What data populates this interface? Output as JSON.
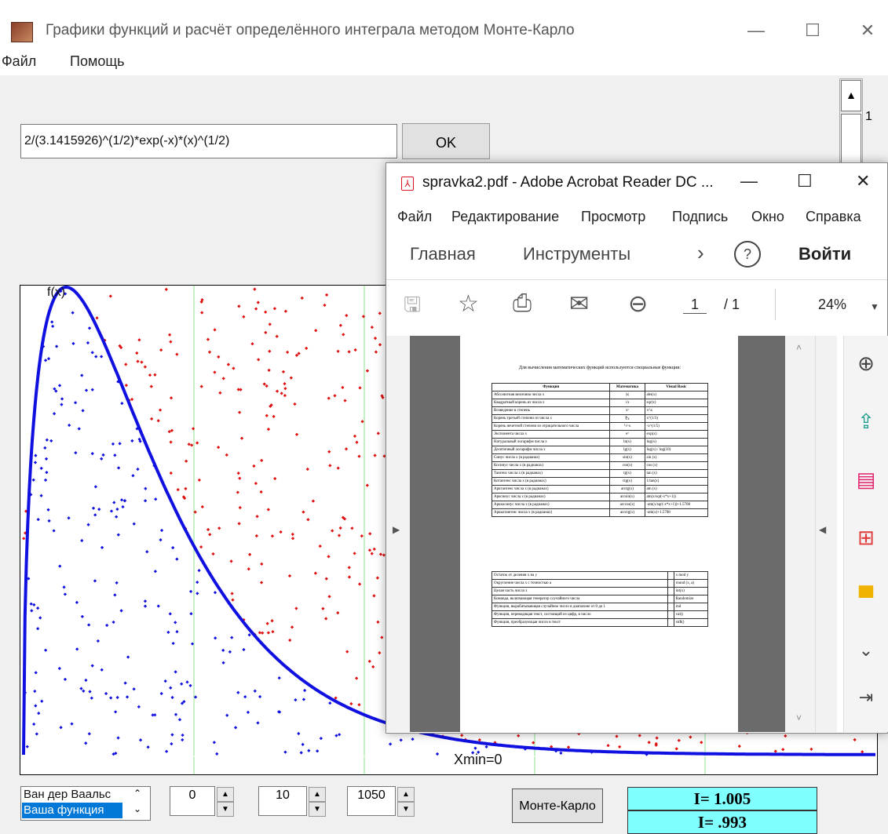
{
  "main_window": {
    "title": "Графики функций и расчёт определённого интеграла методом Монте-Карло",
    "controls": [
      "—",
      "☐",
      "✕"
    ],
    "menu": [
      "Файл",
      "Помощь"
    ],
    "formula": "2/(3.1415926)^(1/2)*exp(-x)*(x)^(1/2)",
    "ok_label": "OK",
    "scroll_value": "1"
  },
  "plot": {
    "fx_label": "f(x)",
    "xmin_label": "Xmin=0",
    "colors": {
      "curve": "#1010e0",
      "below": "#1010e0",
      "above": "#e01010",
      "grid": "#8ee08e"
    }
  },
  "bottom": {
    "listbox": [
      "Ван дер Ваальс",
      "Ваша функция"
    ],
    "spin_values": [
      "0",
      "10",
      "1050"
    ],
    "mc_label": "Монте-Карло",
    "results": [
      "I= 1.005",
      "I= .993"
    ]
  },
  "acrobat": {
    "title": "spravka2.pdf - Adobe Acrobat Reader DC ...",
    "controls": [
      "—",
      "☐",
      "✕"
    ],
    "menu": [
      "Файл",
      "Редактирование",
      "Просмотр",
      "Подпись",
      "Окно",
      "Справка"
    ],
    "nav": [
      "Главная",
      "Инструменты",
      "›",
      "?",
      "Войти"
    ],
    "toolbar_icons": [
      "save-icon",
      "star-icon",
      "print-icon",
      "mail-icon",
      "zoom-out-icon"
    ],
    "page_number": "1",
    "page_total": "/ 1",
    "zoom": "24%",
    "side_icons": [
      "zoom-in-icon",
      "export-pdf-icon",
      "organize-pages-icon",
      "create-pdf-icon",
      "comment-icon",
      "chevron-down-icon",
      "collapse-panel-icon"
    ],
    "pdf": {
      "heading": "Для вычисления математических функций используются специальные функции:",
      "table1_header": [
        "Функция",
        "Математика",
        "Visual Basic"
      ],
      "table1_rows": [
        [
          "Абсолютная величина числа x",
          "|x|",
          "abs(x)"
        ],
        [
          "Квадратный корень из числа x",
          "√x",
          "sqr(x)"
        ],
        [
          "Возведение в степень",
          "xᵃ",
          "x^a"
        ],
        [
          "Корень третьей степени из числа x",
          "∛x",
          "x^(1/3)"
        ],
        [
          "Корень нечетной степени из отрицательного числа",
          "⁵√-x",
          "-x^(1/5)"
        ],
        [
          "Экспонента числа x",
          "eˣ",
          "exp(x)"
        ],
        [
          "Натуральный логарифм числа x",
          "ln(x)",
          "log(x)"
        ],
        [
          "Десятичный логарифм числа x",
          "lg(x)",
          "log(x) / log(10)"
        ],
        [
          "Синус числа x (в радианах)",
          "sin(x)",
          "sin (x)"
        ],
        [
          "Косинус числа x (в радианах)",
          "cos(x)",
          "cos (x)"
        ],
        [
          "Тангенс числа x (в радианах)",
          "tg(x)",
          "tan (x)"
        ],
        [
          "Котангенс числа x (в радианах)",
          "ctg(x)",
          "1/tan(x)"
        ],
        [
          "Арктангенс числа x (в радианах)",
          "arctg(x)",
          "atn (x)"
        ],
        [
          "Арксинус числа x (в радианах)",
          "arcsin(x)",
          "atn(x/sqr(-x*x+1))"
        ],
        [
          "Арккосинус числа x (в радианах)",
          "arccos(x)",
          "-atn(x/sqr(-x*x+1))+1.5708"
        ],
        [
          "Арккотангенс числа x (в радианах)",
          "arcctg(x)",
          "-atn(x)+1.5708"
        ]
      ],
      "table2_rows": [
        [
          "Остаток от деления x на y",
          "",
          "x mod y"
        ],
        [
          "Округление числа x с точностью a",
          "",
          "round (x, a)"
        ],
        [
          "Целая часть числа x",
          "",
          "int(x)"
        ],
        [
          "Команда, включающая генератор случайного числа",
          "",
          "Randomize"
        ],
        [
          "Функция, вырабатывающая случайное число в диапазоне от 0 до 1",
          "",
          "rnd"
        ],
        [
          "Функция, переводящая текст, состоящий из цифр, в число",
          "",
          "val()"
        ],
        [
          "Функция, преобразующая число в текст",
          "",
          "str$()"
        ]
      ]
    }
  }
}
